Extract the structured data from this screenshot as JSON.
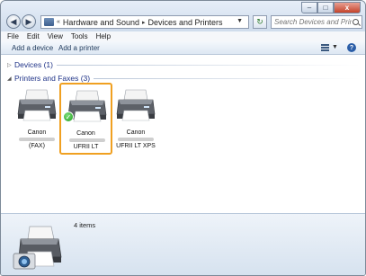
{
  "window": {
    "buttons": {
      "minimize": "–",
      "maximize": "□",
      "close": "x"
    }
  },
  "nav": {
    "back": "◀",
    "forward": "▶",
    "path": [
      "«",
      "Hardware and Sound",
      "▸",
      "Devices and Printers"
    ],
    "refresh": "↻",
    "search_placeholder": "Search Devices and Printers"
  },
  "menu": [
    "File",
    "Edit",
    "View",
    "Tools",
    "Help"
  ],
  "commands": {
    "add_device": "Add a device",
    "add_printer": "Add a printer",
    "help": "?"
  },
  "groups": {
    "devices": {
      "title": "Devices (1)",
      "arrow": "▷"
    },
    "printers": {
      "title": "Printers and Faxes (3)",
      "arrow": "◢"
    }
  },
  "printers": [
    {
      "name": "Canon",
      "sub": "(FAX)",
      "selected": false,
      "default": false
    },
    {
      "name": "Canon",
      "sub": "UFRII LT",
      "selected": true,
      "default": true
    },
    {
      "name": "Canon",
      "sub": "UFRII LT XPS",
      "selected": false,
      "default": false
    }
  ],
  "details": {
    "count": "4 items"
  },
  "colors": {
    "selection": "#f0a021",
    "group_title": "#1e3287",
    "accent": "#2b5ea8"
  },
  "icons": [
    "back-arrow-icon",
    "forward-arrow-icon",
    "folder-icon",
    "refresh-icon",
    "search-icon",
    "views-icon",
    "help-icon",
    "printer-icon",
    "default-check-icon",
    "camera-printer-icon"
  ]
}
